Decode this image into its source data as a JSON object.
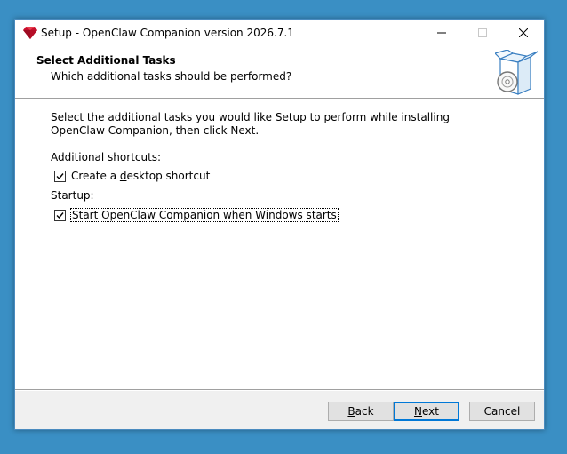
{
  "window": {
    "title": "Setup - OpenClaw Companion version 2026.7.1",
    "app_icon": "ruby-gem-icon"
  },
  "header": {
    "title": "Select Additional Tasks",
    "subtitle": "Which additional tasks should be performed?",
    "graphic": "setup-box-icon"
  },
  "content": {
    "description": "Select the additional tasks you would like Setup to perform while installing OpenClaw Companion, then click Next.",
    "groups": [
      {
        "label": "Additional shortcuts:",
        "tasks": [
          {
            "label_pre": "Create a ",
            "label_accel": "d",
            "label_post": "esktop shortcut",
            "checked": true
          }
        ]
      },
      {
        "label": "Startup:",
        "tasks": [
          {
            "label_pre": "Start OpenClaw Companion when Windows starts",
            "label_accel": "",
            "label_post": "",
            "checked": true
          }
        ]
      }
    ]
  },
  "buttons": {
    "back_accel": "B",
    "back_rest": "ack",
    "next_accel": "N",
    "next_rest": "ext",
    "cancel": "Cancel"
  },
  "colors": {
    "desktop": "#3a8fc4",
    "accent": "#0078d7"
  }
}
